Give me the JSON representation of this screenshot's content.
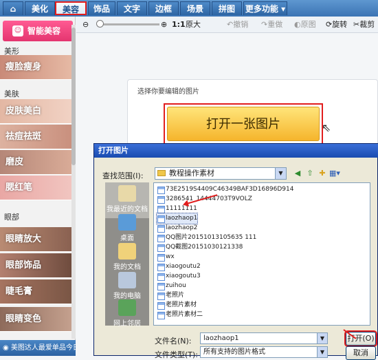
{
  "tabs": [
    {
      "label": "美化"
    },
    {
      "label": "美容"
    },
    {
      "label": "饰品"
    },
    {
      "label": "文字"
    },
    {
      "label": "边框"
    },
    {
      "label": "场景"
    },
    {
      "label": "拼图"
    },
    {
      "label": "更多功能 ▾"
    }
  ],
  "sidebar": {
    "smart_button": "智能美容",
    "sections": [
      "美形",
      "美肤",
      "眼部"
    ],
    "items": [
      "瘦脸瘦身",
      "皮肤美白",
      "祛痘祛斑",
      "磨皮",
      "腮红笔",
      "眼睛放大",
      "眼部饰品",
      "睫毛膏",
      "眼睛变色"
    ],
    "bottom_text": "美图达人最爱单品今日上新!"
  },
  "toolbar": {
    "zoom_ratio": "1:1",
    "original_size": "原大",
    "undo": "撤销",
    "redo": "重做",
    "original": "原图",
    "rotate": "旋转",
    "crop": "裁剪"
  },
  "canvas": {
    "prompt": "选择你要编辑的图片",
    "open_button": "打开一张图片"
  },
  "dialog": {
    "title": "打开图片",
    "look_in_label": "查找范围(I):",
    "folder": "教程操作素材",
    "places": [
      "我最近的文档",
      "桌面",
      "我的文档",
      "我的电脑",
      "网上邻居"
    ],
    "files": [
      "73E2519S4409C46349BAF3D16896D914",
      "3286541_14444703T9VOLZ",
      "11111111",
      "laozhaop1",
      "laozhaop2",
      "QQ图片20151013105635 111",
      "QQ截图20151030121338",
      "wx",
      "xiaogoutu2",
      "xiaogoutu3",
      "zuihou",
      "老照片",
      "老照片素材",
      "老照片素材二"
    ],
    "selected_file": "laozhaop1",
    "filename_label": "文件名(N):",
    "filename_value": "laozhaop1",
    "filetype_label": "文件类型(T):",
    "filetype_value": "所有支持的图片格式",
    "open_button": "打开(O)",
    "cancel_button": "取消"
  },
  "colors": {
    "accent": "#e11d1d",
    "tab_blue": "#3b74b4",
    "smart_pink": "#e4356f"
  }
}
